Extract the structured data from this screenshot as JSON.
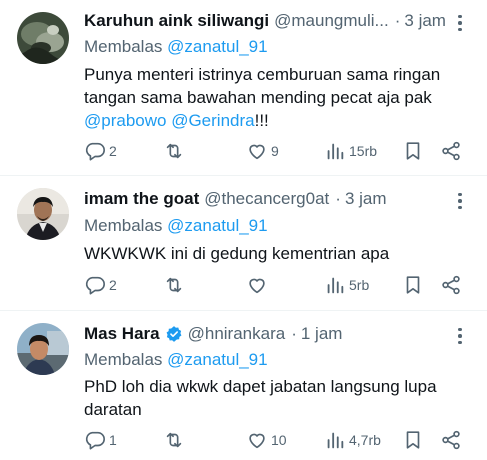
{
  "tweets": [
    {
      "name": "Karuhun aink siliwangi",
      "handle": "@maungmuli...",
      "separator": "·",
      "time": "3 jam",
      "reply_prefix": "Membalas",
      "reply_to": "@zanatul_91",
      "text_line1": "Punya menteri istrinya cemburuan sama ringan",
      "text_line2": "tangan sama bawahan mending pecat aja pak",
      "mention1": "@prabowo",
      "mention2": "@Gerindra",
      "text_suffix": "!!!",
      "replies": "2",
      "retweets": "",
      "likes": "9",
      "views": "15rb"
    },
    {
      "name": "imam the goat",
      "handle": "@thecancerg0at",
      "separator": "·",
      "time": "3 jam",
      "reply_prefix": "Membalas",
      "reply_to": "@zanatul_91",
      "text_line1": "WKWKWK ini di gedung kementrian apa",
      "replies": "2",
      "retweets": "",
      "likes": "",
      "views": "5rb"
    },
    {
      "name": "Mas Hara",
      "handle": "@hnirankara",
      "separator": "·",
      "time": "1 jam",
      "verified": true,
      "reply_prefix": "Membalas",
      "reply_to": "@zanatul_91",
      "text_line1": "PhD loh dia wkwk dapet jabatan langsung lupa",
      "text_line2": "daratan",
      "replies": "1",
      "retweets": "",
      "likes": "10",
      "views": "4,7rb"
    }
  ],
  "colors": {
    "text": "#0f1419",
    "secondary": "#536471",
    "link": "#1d9bf0",
    "divider": "#eff3f4",
    "verified": "#1d9bf0"
  },
  "icons": [
    "reply-icon",
    "retweet-icon",
    "like-icon",
    "views-icon",
    "bookmark-icon",
    "share-icon",
    "more-icon",
    "verified-badge-icon"
  ]
}
